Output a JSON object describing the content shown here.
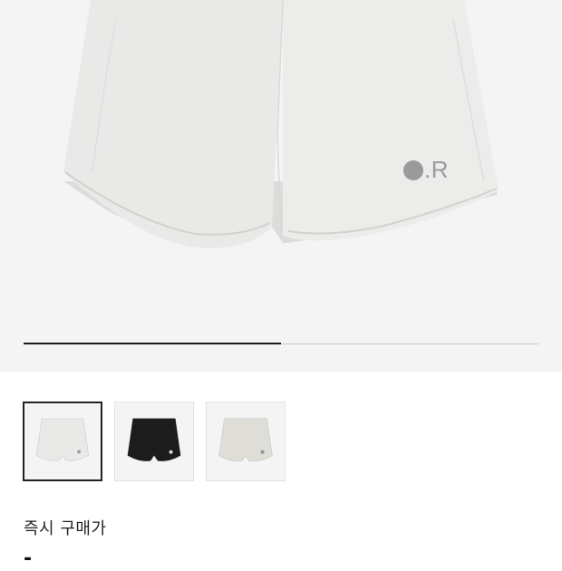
{
  "product": {
    "brand_mark": ".R",
    "colors": {
      "light": "#e9e9e7",
      "black": "#1c1c1c",
      "beige": "#deddd8",
      "logo": "#9a9a9a"
    }
  },
  "gallery": {
    "progress": 0.5,
    "thumbnails": [
      {
        "color": "light",
        "selected": true
      },
      {
        "color": "black",
        "selected": false
      },
      {
        "color": "beige",
        "selected": false
      }
    ]
  },
  "price": {
    "label": "즉시 구매가",
    "value": "-"
  }
}
